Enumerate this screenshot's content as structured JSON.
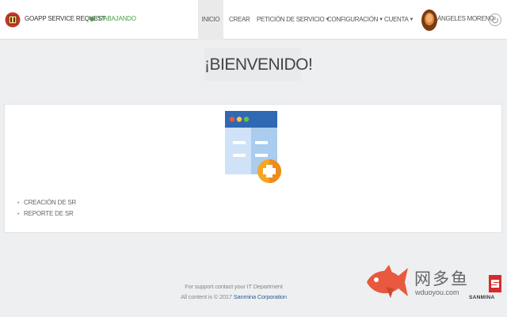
{
  "navbar": {
    "brand": "GOAPP SERVICE REQUEST",
    "status": "TRABAJANDO",
    "items": [
      {
        "label": "INICIO",
        "active": true
      },
      {
        "label": "CREAR"
      },
      {
        "label": "PETICIÓN DE SERVICIO",
        "caret": true
      },
      {
        "label": "CONFIGURACIÓN",
        "caret": true
      },
      {
        "label": "CUENTA",
        "caret": true
      }
    ],
    "user": "ÁNGELES MORENO",
    "icons": {
      "logo": "goapp-logo-icon",
      "power": "power-icon",
      "caret": "chevron-down-icon"
    }
  },
  "welcome": {
    "title": "¡BIENVENIDO!"
  },
  "panel": {
    "illustration": "document-add-icon",
    "links": [
      {
        "label": "CREACIÓN DE SR"
      },
      {
        "label": "REPORTE DE SR"
      }
    ]
  },
  "footer": {
    "support": "For support contact your IT Department",
    "copyright_prefix": "All content is © 2017",
    "copyright_company": "Sanmina Corporation"
  },
  "watermark": {
    "site_cn": "网多鱼",
    "site_url": "wduoyou.com",
    "brand": "SANMINA"
  },
  "colors": {
    "status_green": "#4ca04c",
    "accent_blue": "#2d5f96",
    "badge_orange": "#f5a623",
    "fish_red": "#e8593f"
  }
}
